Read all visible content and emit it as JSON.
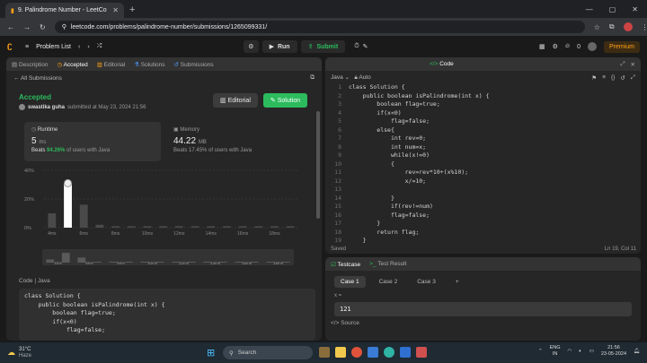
{
  "browser": {
    "tab_title": "9. Palindrome Number - LeetCo",
    "url": "leetcode.com/problems/palindrome-number/submissions/1265099331/"
  },
  "nav": {
    "problem_list": "Problem List",
    "run": "Run",
    "submit": "Submit",
    "streak": "0",
    "premium": "Premium"
  },
  "left_tabs": [
    {
      "label": "Description",
      "active": false
    },
    {
      "label": "Accepted",
      "active": true
    },
    {
      "label": "Editorial",
      "active": false
    },
    {
      "label": "Solutions",
      "active": false
    },
    {
      "label": "Submissions",
      "active": false
    }
  ],
  "submission": {
    "back_label": "All Submissions",
    "status": "Accepted",
    "user": "swastika guha",
    "submitted_text": "submitted at May 23, 2024 21:56",
    "editorial_btn": "Editorial",
    "solution_btn": "Solution"
  },
  "runtime": {
    "label": "Runtime",
    "value": "5",
    "unit": "ms",
    "beats_prefix": "Beats",
    "beats_pct": "94.26%",
    "beats_suffix": "of users with Java"
  },
  "memory": {
    "label": "Memory",
    "value": "44.22",
    "unit": "MB",
    "beats_text": "Beats 17.45% of users with Java"
  },
  "chart_data": {
    "type": "bar",
    "y_ticks": [
      "40%",
      "20%",
      "0%"
    ],
    "ylim": [
      0,
      40
    ],
    "categories": [
      "4ms",
      "6ms",
      "8ms",
      "10ms",
      "12ms",
      "14ms",
      "16ms",
      "18ms"
    ],
    "values": [
      10,
      31,
      16,
      2,
      1,
      1,
      1,
      1,
      1,
      1,
      1,
      1,
      1,
      1,
      1,
      1
    ],
    "highlight_index": 1,
    "mini_labels": [
      "4ms",
      "5ms",
      "5ms",
      "10ms",
      "12ms",
      "14ms",
      "16ms",
      "18ms"
    ]
  },
  "code_section": {
    "label": "Code",
    "lang": "Java",
    "lines": [
      "class Solution {",
      "    public boolean isPalindrome(int x) {",
      "        boolean flag=true;",
      "        if(x<0)",
      "            flag=false;"
    ]
  },
  "editor": {
    "tab_code": "Code",
    "lang": "Java",
    "mode": "Auto",
    "lines": [
      "class Solution {",
      "    public boolean isPalindrome(int x) {",
      "        boolean flag=true;",
      "        if(x<0)",
      "            flag=false;",
      "        else{",
      "            int rev=0;",
      "            int num=x;",
      "            while(x!=0)",
      "            {",
      "                rev=rev*10+(x%10);",
      "                x/=10;",
      "",
      "            }",
      "            if(rev!=num)",
      "            flag=false;",
      "        }",
      "        return flag;",
      "    }"
    ],
    "saved": "Saved",
    "cursor": "Ln 19, Col 11"
  },
  "testcase": {
    "tab_testcase": "Testcase",
    "tab_result": "Test Result",
    "cases": [
      "Case 1",
      "Case 2",
      "Case 3"
    ],
    "var_label": "x =",
    "value": "121",
    "source": "Source"
  },
  "taskbar": {
    "weather_temp": "31°C",
    "weather_desc": "Haze",
    "search": "Search",
    "lang": "ENG",
    "region": "IN",
    "time": "21:56",
    "date": "23-05-2024"
  }
}
